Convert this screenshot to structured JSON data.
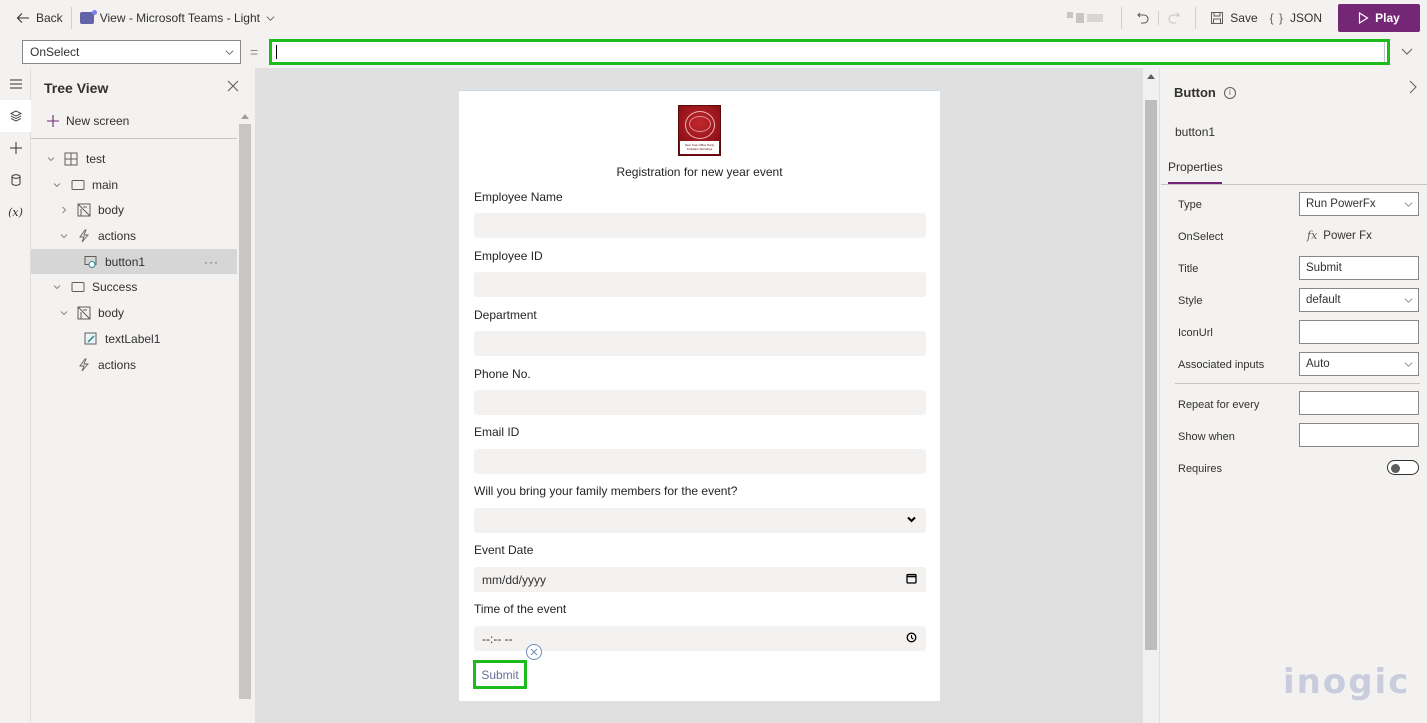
{
  "topbar": {
    "back_label": "Back",
    "app_title": "View - Microsoft Teams - Light",
    "save_label": "Save",
    "json_label": "JSON",
    "play_label": "Play",
    "play_color": "#742774"
  },
  "formula_bar": {
    "property": "OnSelect",
    "equals": "=",
    "formula_value": "",
    "highlight_color": "#1dbc1d"
  },
  "rail": {
    "items": [
      {
        "icon": "hamburger-icon"
      },
      {
        "icon": "layers-icon",
        "active": true
      },
      {
        "icon": "plus-icon"
      },
      {
        "icon": "database-icon"
      },
      {
        "icon": "variables-icon",
        "glyph": "(x)"
      }
    ]
  },
  "tree": {
    "title": "Tree View",
    "new_screen_label": "New screen",
    "nodes": [
      {
        "label": "test",
        "type": "screen",
        "level": 0,
        "expanded": true
      },
      {
        "label": "main",
        "type": "container",
        "level": 1,
        "expanded": true
      },
      {
        "label": "body",
        "type": "body",
        "level": 2,
        "expanded": false
      },
      {
        "label": "actions",
        "type": "actions",
        "level": 2,
        "expanded": true
      },
      {
        "label": "button1",
        "type": "button",
        "level": 3,
        "selected": true
      },
      {
        "label": "Success",
        "type": "container",
        "level": 1,
        "expanded": true
      },
      {
        "label": "body",
        "type": "body",
        "level": 2,
        "expanded": true
      },
      {
        "label": "textLabel1",
        "type": "label",
        "level": 3
      },
      {
        "label": "actions",
        "type": "actions",
        "level": 2
      }
    ],
    "more_glyph": "···"
  },
  "form": {
    "logo_caption": "New Year Office Party Invitation Wordings",
    "title": "Registration for new year event",
    "fields": [
      {
        "label": "Employee Name",
        "kind": "text",
        "value": ""
      },
      {
        "label": "Employee ID",
        "kind": "text",
        "value": ""
      },
      {
        "label": "Department",
        "kind": "text",
        "value": ""
      },
      {
        "label": "Phone No.",
        "kind": "text",
        "value": ""
      },
      {
        "label": "Email ID",
        "kind": "text",
        "value": ""
      },
      {
        "label": "Will you bring your family members for the event?",
        "kind": "select",
        "value": ""
      },
      {
        "label": "Event Date",
        "kind": "date",
        "placeholder": "mm/dd/yyyy"
      },
      {
        "label": "Time of the event",
        "kind": "time",
        "placeholder": "--:-- --"
      }
    ],
    "submit_label": "Submit"
  },
  "properties": {
    "control_type": "Button",
    "control_name": "button1",
    "tab_label": "Properties",
    "rows": {
      "type": {
        "label": "Type",
        "value": "Run PowerFx"
      },
      "onselect": {
        "label": "OnSelect",
        "value": "Power Fx",
        "glyph": "fx"
      },
      "title": {
        "label": "Title",
        "value": "Submit"
      },
      "style": {
        "label": "Style",
        "value": "default"
      },
      "iconurl": {
        "label": "IconUrl",
        "value": ""
      },
      "associated": {
        "label": "Associated inputs",
        "value": "Auto"
      },
      "repeat": {
        "label": "Repeat for every",
        "value": ""
      },
      "showwhen": {
        "label": "Show when",
        "value": ""
      },
      "requires": {
        "label": "Requires",
        "value": false
      }
    }
  },
  "watermark": "inogic"
}
